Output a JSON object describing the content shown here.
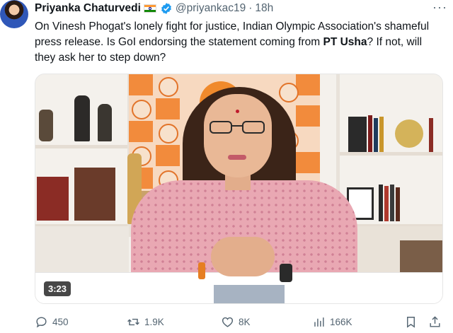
{
  "author": {
    "name": "Priyanka Chaturvedi",
    "handle": "@priyankac19",
    "separator": "·",
    "time": "18h"
  },
  "tweet": {
    "text_1": "On Vinesh Phogat's lonely fight for justice, Indian Olympic Association's shameful press release. Is GoI endorsing the statement coming from ",
    "bold_1": "PT Usha",
    "text_2": "? If not, will they ask her to step down?"
  },
  "video": {
    "duration": "3:23"
  },
  "actions": {
    "replies": "450",
    "reposts": "1.9K",
    "likes": "8K",
    "views": "166K"
  },
  "colors": {
    "text": "#0f1419",
    "secondary": "#536471",
    "verified": "#1d9bf0"
  },
  "icons": [
    "more-icon",
    "verified-badge-icon",
    "india-flag-icon",
    "reply-icon",
    "repost-icon",
    "like-icon",
    "views-icon",
    "bookmark-icon",
    "share-icon"
  ]
}
